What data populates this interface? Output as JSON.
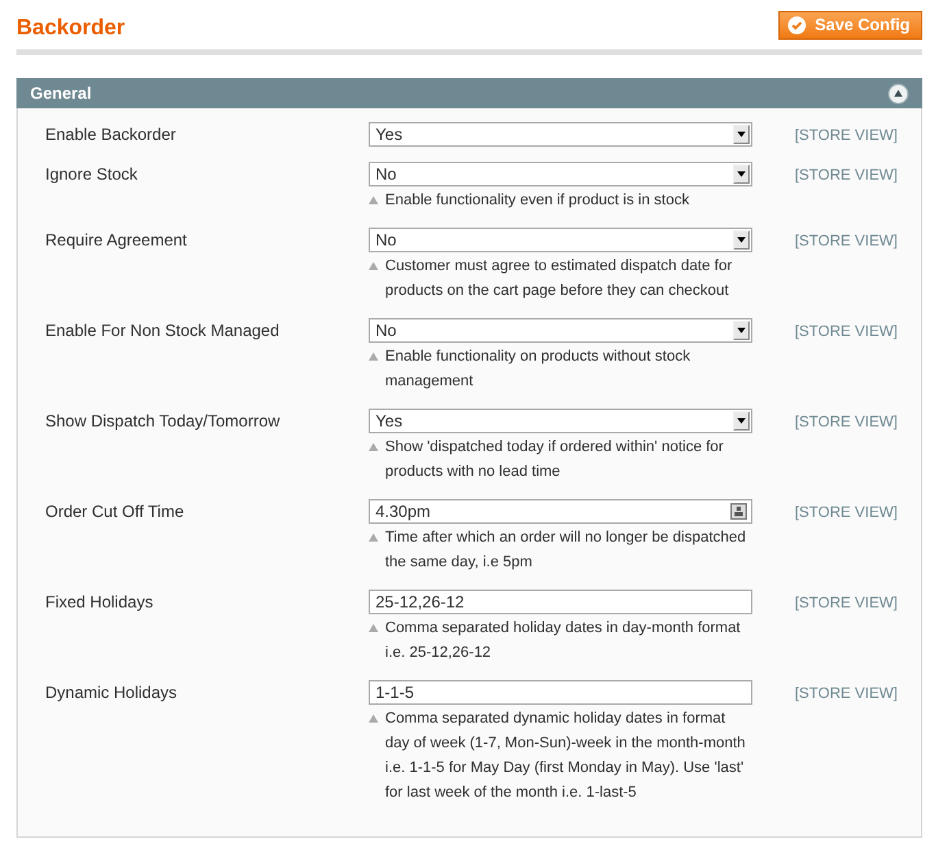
{
  "page": {
    "title": "Backorder",
    "save_button": "Save Config"
  },
  "section": {
    "title": "General",
    "expanded": true,
    "rows": [
      {
        "kind": "select",
        "label": "Enable Backorder",
        "value": "Yes",
        "scope": "[STORE VIEW]"
      },
      {
        "kind": "select",
        "label": "Ignore Stock",
        "value": "No",
        "note": "Enable functionality even if product is in stock",
        "scope": "[STORE VIEW]"
      },
      {
        "kind": "select",
        "label": "Require Agreement",
        "value": "No",
        "note": "Customer must agree to estimated dispatch date for products on the cart page before they can checkout",
        "scope": "[STORE VIEW]"
      },
      {
        "kind": "select",
        "label": "Enable For Non Stock Managed",
        "value": "No",
        "note": "Enable functionality on products without stock management",
        "scope": "[STORE VIEW]"
      },
      {
        "kind": "select",
        "label": "Show Dispatch Today/Tomorrow",
        "value": "Yes",
        "note": "Show 'dispatched today if ordered within' notice for products with no lead time",
        "scope": "[STORE VIEW]"
      },
      {
        "kind": "time",
        "label": "Order Cut Off Time",
        "value": "4.30pm",
        "note": "Time after which an order will no longer be dispatched the same day, i.e 5pm",
        "scope": "[STORE VIEW]"
      },
      {
        "kind": "text",
        "label": "Fixed Holidays",
        "value": "25-12,26-12",
        "note": "Comma separated holiday dates in day-month format i.e. 25-12,26-12",
        "scope": "[STORE VIEW]"
      },
      {
        "kind": "text",
        "label": "Dynamic Holidays",
        "value": "1-1-5",
        "note": "Comma separated dynamic holiday dates in format day of week (1-7, Mon-Sun)-week in the month-month i.e. 1-1-5 for May Day (first Monday in May). Use 'last' for last week of the month i.e. 1-last-5",
        "scope": "[STORE VIEW]"
      }
    ]
  }
}
